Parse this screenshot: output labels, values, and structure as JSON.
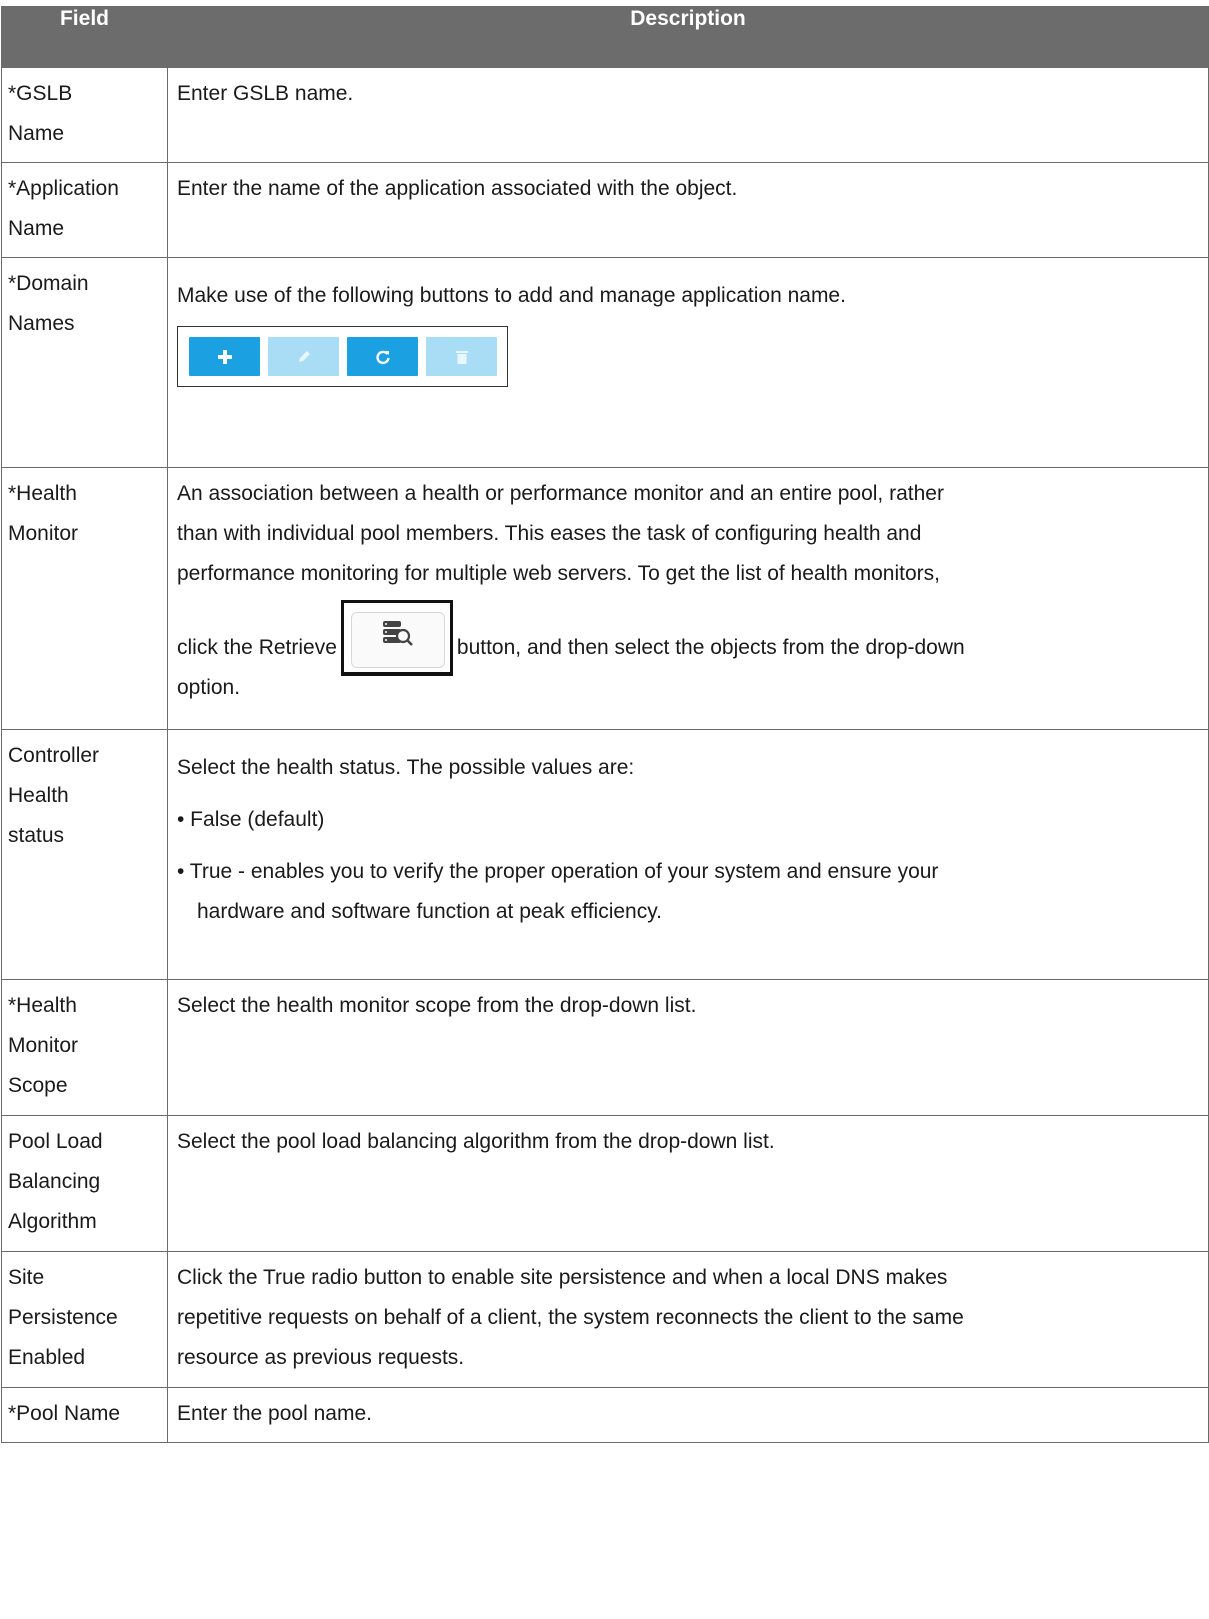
{
  "header": {
    "field": "Field",
    "description": "Description"
  },
  "rows": [
    {
      "field": [
        "*GSLB",
        "Name"
      ],
      "desc": [
        "Enter GSLB name."
      ]
    },
    {
      "field": [
        "*Application",
        "Name"
      ],
      "desc": [
        "Enter the name of the application associated with the object."
      ]
    },
    {
      "field": [
        "*Domain",
        "Names"
      ],
      "desc": [
        "Make use of the following buttons to add and manage application name."
      ],
      "toolbar": [
        "plus-icon",
        "pencil-icon",
        "refresh-icon",
        "trash-icon"
      ]
    },
    {
      "field": [
        "*Health",
        "Monitor"
      ],
      "desc": [
        "An association between a health or performance monitor and an entire pool, rather",
        "than with individual pool members. This eases the task of configuring health and",
        "performance monitoring for multiple web servers. To get the list of health monitors,"
      ],
      "retrieve_before": "click the Retrieve",
      "retrieve_after": "button, and then select the objects from the drop-down",
      "last": "option."
    },
    {
      "field": [
        "Controller",
        "Health",
        "status"
      ],
      "desc": [
        "Select the health status. The possible values are:"
      ],
      "bullets": [
        [
          "• False (default)"
        ],
        [
          "• True - enables you to verify the proper operation of your system and ensure your",
          "hardware and software function at peak efficiency."
        ]
      ]
    },
    {
      "field": [
        "*Health",
        "Monitor",
        "Scope"
      ],
      "desc": [
        "Select the health monitor scope from the drop-down list."
      ]
    },
    {
      "field": [
        "Pool Load",
        "Balancing",
        "Algorithm"
      ],
      "desc": [
        "Select the pool load balancing algorithm from the drop-down list."
      ]
    },
    {
      "field": [
        "Site",
        "Persistence",
        "Enabled"
      ],
      "desc": [
        "Click the True radio button to enable site persistence and when a local DNS makes",
        "repetitive requests on behalf of a client, the system reconnects the client to the same",
        "resource as previous requests."
      ]
    },
    {
      "field": [
        "*Pool Name"
      ],
      "desc": [
        "Enter the pool name."
      ]
    }
  ]
}
